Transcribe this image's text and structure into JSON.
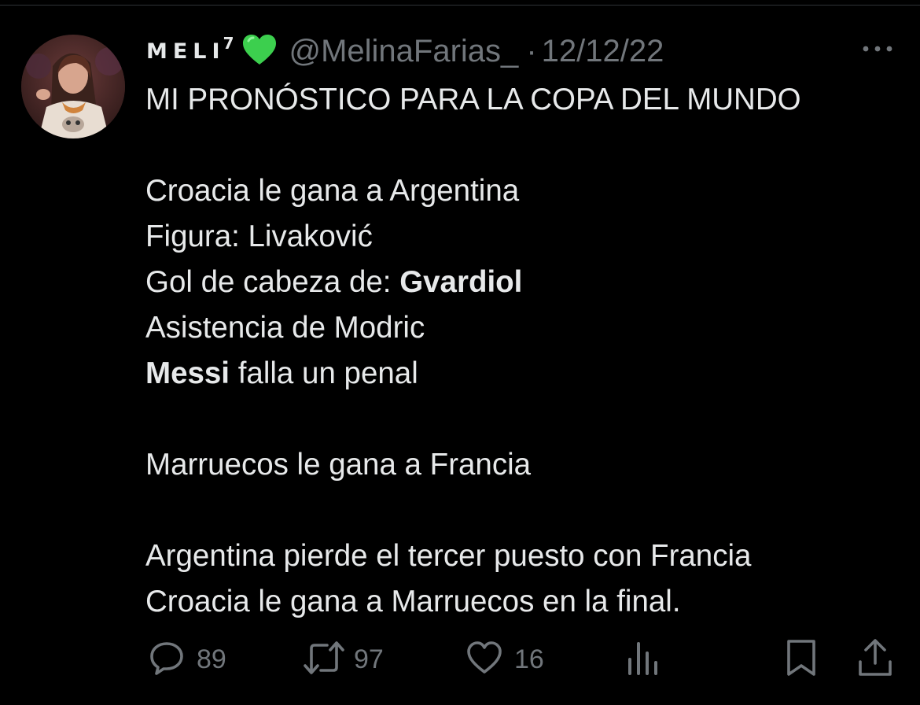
{
  "tweet": {
    "author": {
      "display_name": "MELI",
      "name_superscript": "7",
      "name_emoji": "green-heart-icon",
      "handle": "@MelinaFarias_",
      "separator": "·"
    },
    "date": "12/12/22",
    "lines": [
      {
        "text": "MI PRONÓSTICO PARA LA COPA DEL MUNDO"
      },
      {
        "text": ""
      },
      {
        "text": "Croacia le gana a Argentina"
      },
      {
        "text": "Figura: Livaković"
      },
      {
        "prefix": "Gol de cabeza de: ",
        "bold": "Gvardiol"
      },
      {
        "text": "Asistencia de Modric"
      },
      {
        "bold_lead": "Messi",
        "suffix": " falla un penal"
      },
      {
        "text": ""
      },
      {
        "text": "Marruecos le gana a Francia"
      },
      {
        "text": ""
      },
      {
        "text": "Argentina pierde el tercer puesto con Francia"
      },
      {
        "text": "Croacia le gana a Marruecos en la final."
      }
    ],
    "stats": {
      "replies": "89",
      "retweets": "97",
      "likes": "16"
    },
    "icons": {
      "reply": "reply-icon",
      "retweet": "retweet-icon",
      "like": "heart-icon",
      "views": "views-icon",
      "bookmark": "bookmark-icon",
      "share": "share-icon",
      "more": "more-icon"
    },
    "colors": {
      "background": "#000000",
      "text": "#e7e9ea",
      "secondary": "#71767b",
      "heart_emoji": "#3ccf4e"
    }
  }
}
